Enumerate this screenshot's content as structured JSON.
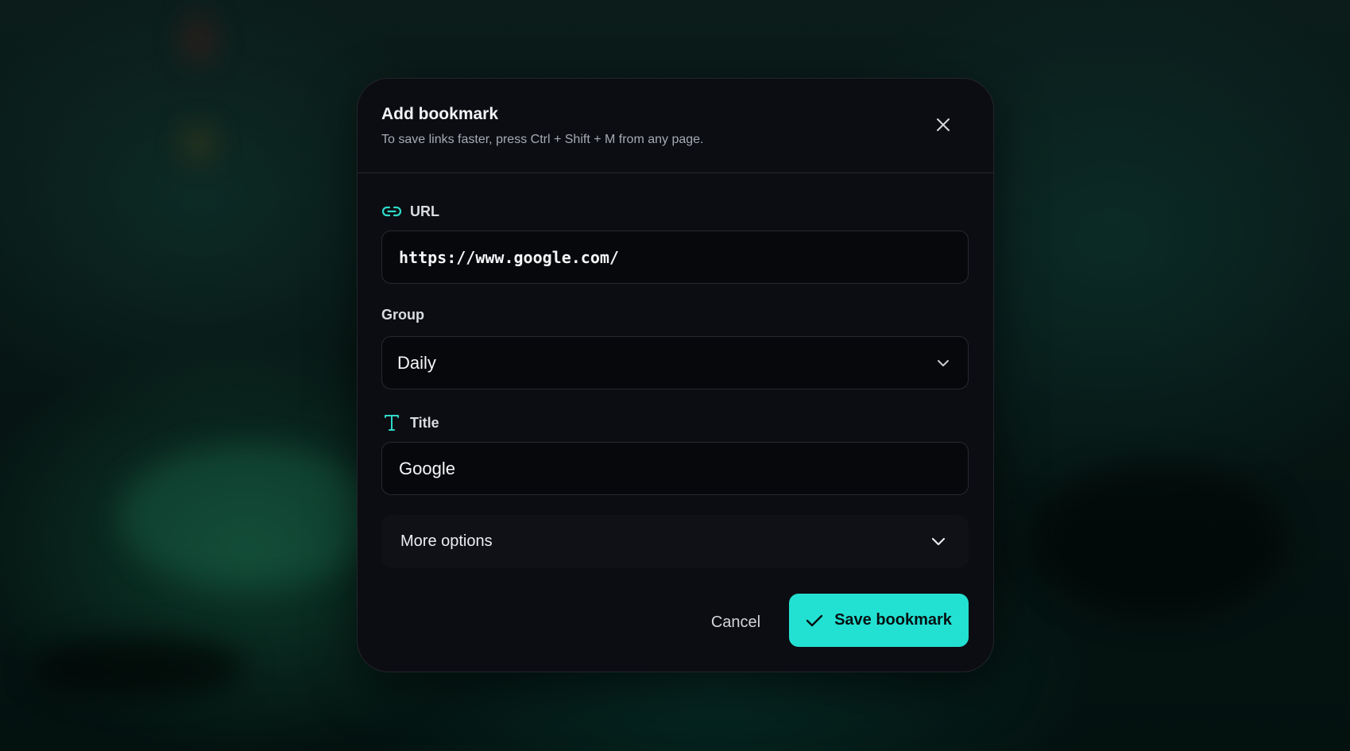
{
  "dialog": {
    "title": "Add bookmark",
    "subtitle": "To save links faster, press Ctrl + Shift + M from any page.",
    "close_icon": "close-icon"
  },
  "url_field": {
    "label": "URL",
    "icon": "link-icon",
    "value": "https://www.google.com/"
  },
  "group_field": {
    "label": "Group",
    "selected": "Daily",
    "icon": "chevron-down-icon"
  },
  "title_field": {
    "label": "Title",
    "icon": "text-type-icon",
    "value": "Google"
  },
  "more_options": {
    "label": "More options",
    "icon": "chevron-down-icon"
  },
  "actions": {
    "cancel_label": "Cancel",
    "save_label": "Save bookmark",
    "save_icon": "check-icon"
  },
  "colors": {
    "accent": "#23e1d2",
    "dialog_bg": "#0c0d12",
    "input_bg": "#07080b",
    "backdrop": "#04100f"
  }
}
